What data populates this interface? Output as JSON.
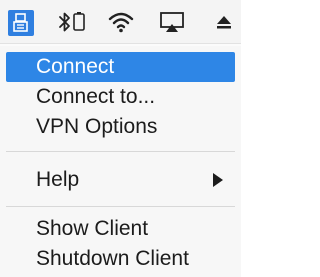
{
  "menubar": {
    "icons": [
      "vpn-client-icon",
      "bluetooth-icon",
      "wifi-icon",
      "airplay-icon",
      "eject-icon"
    ],
    "active_color": "#2e86e6"
  },
  "menu": {
    "items": [
      {
        "label": "Connect",
        "active": true
      },
      {
        "label": "Connect to..."
      },
      {
        "label": "VPN Options"
      },
      {
        "label": "Help",
        "has_submenu": true
      },
      {
        "label": "Show Client"
      },
      {
        "label": "Shutdown Client"
      }
    ]
  }
}
